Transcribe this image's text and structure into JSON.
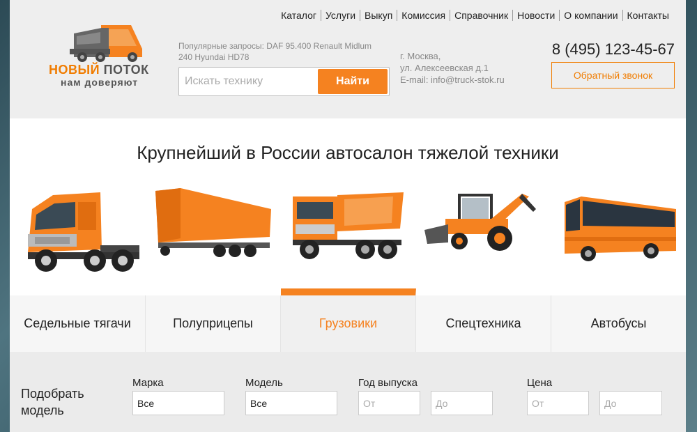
{
  "nav": [
    "Каталог",
    "Услуги",
    "Выкуп",
    "Комиссия",
    "Справочник",
    "Новости",
    "О компании",
    "Контакты"
  ],
  "logo": {
    "brand_a": "НОВЫЙ",
    "brand_b": "ПОТОК",
    "tagline": "нам доверяют"
  },
  "popular": "Популярные запросы: DAF 95.400 Renault Midlum 240 Hyundai HD78",
  "search": {
    "placeholder": "Искать технику",
    "button": "Найти"
  },
  "address": [
    "г. Москва,",
    "ул. Алексеевская д.1",
    "E-mail: info@truck-stok.ru"
  ],
  "phone": "8 (495) 123-45-67",
  "callback": "Обратный звонок",
  "hero": {
    "title": "Крупнейший в России автосалон тяжелой техники"
  },
  "tabs": [
    {
      "label": "Седельные тягачи"
    },
    {
      "label": "Полуприцепы"
    },
    {
      "label": "Грузовики"
    },
    {
      "label": "Спецтехника"
    },
    {
      "label": "Автобусы"
    }
  ],
  "active_tab": "Грузовики",
  "filter": {
    "title_1": "Подобрать",
    "title_2": "модель",
    "brand_label": "Марка",
    "brand_value": "Все",
    "model_label": "Модель",
    "model_value": "Все",
    "year_label": "Год выпуска",
    "year_from": "От",
    "year_to": "До",
    "price_label": "Цена",
    "price_from": "От",
    "price_to": "До"
  },
  "colors": {
    "accent": "#f58220",
    "accent_dark": "#f07c00",
    "text": "#222222"
  },
  "icons": [
    "truck-logo-icon",
    "tractor-unit-icon",
    "semi-trailer-icon",
    "dump-truck-icon",
    "backhoe-loader-icon",
    "bus-icon"
  ]
}
